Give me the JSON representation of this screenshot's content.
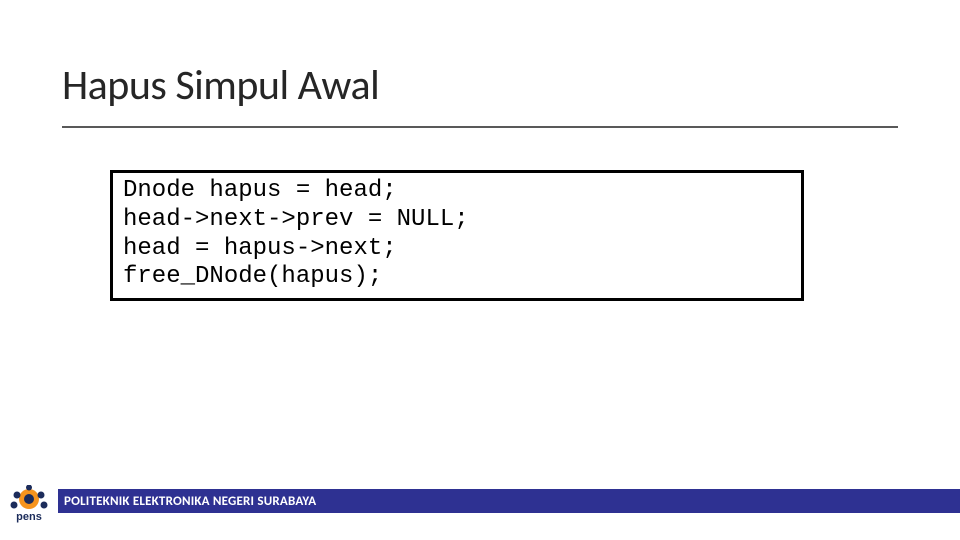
{
  "slide": {
    "title": "Hapus Simpul Awal",
    "code": "Dnode hapus = head;\nhead->next->prev = NULL;\nhead = hapus->next;\nfree_DNode(hapus);",
    "footer": "POLITEKNIK ELEKTRONIKA NEGERI SURABAYA",
    "logo_text": "pens"
  }
}
